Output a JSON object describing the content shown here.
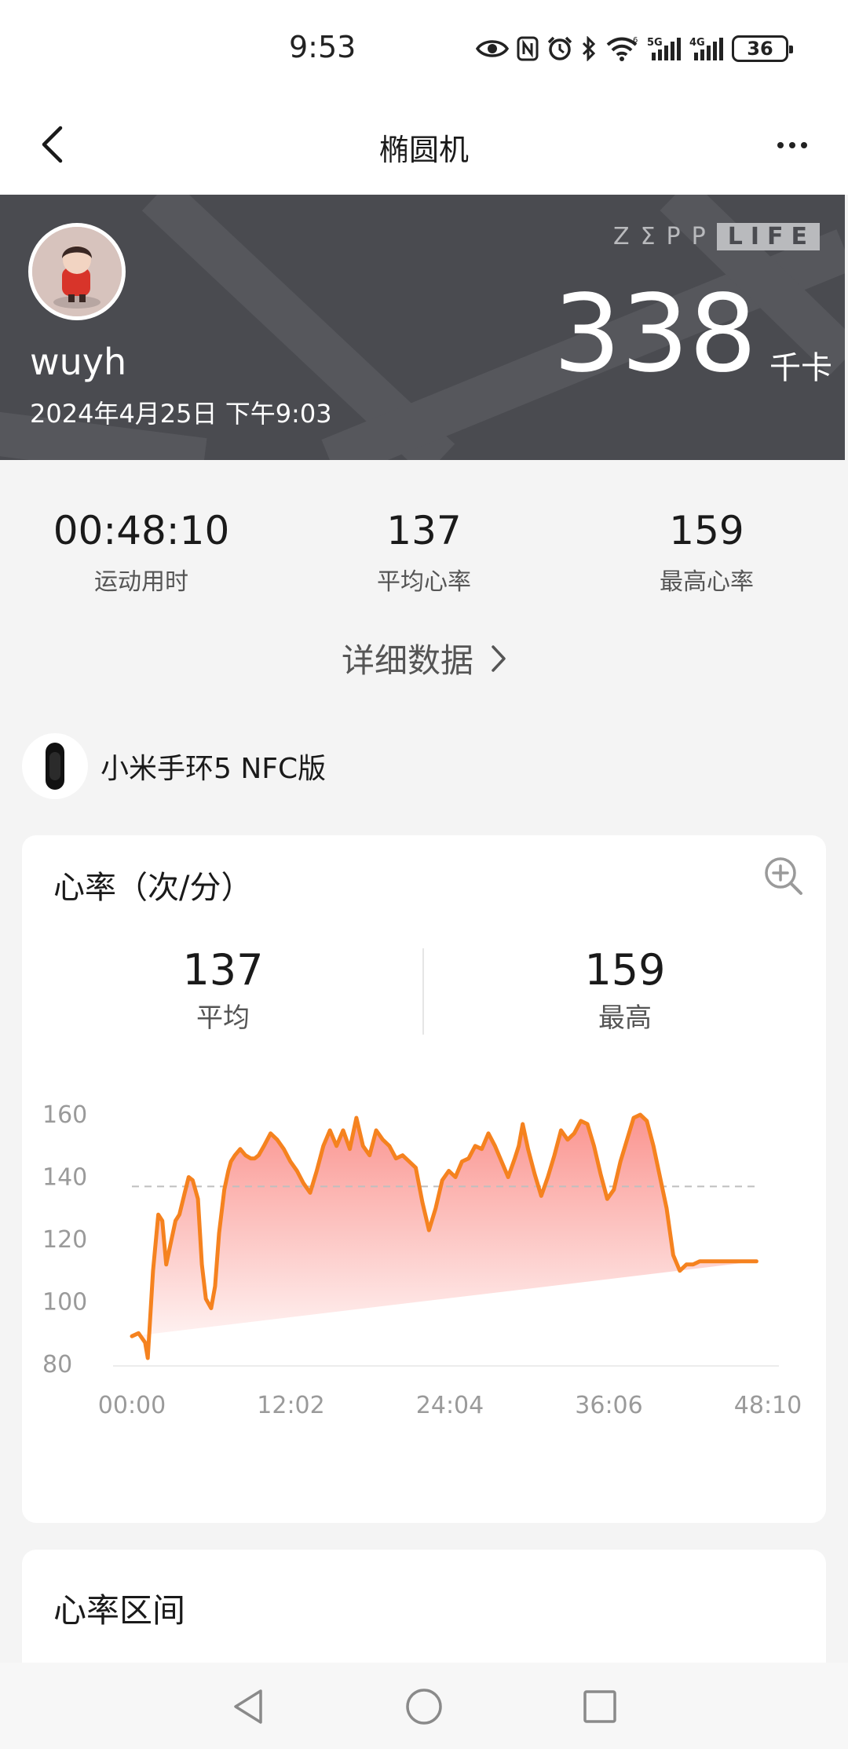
{
  "status_bar": {
    "time": "9:53",
    "battery": "36",
    "icons": [
      "eye-icon",
      "nfc-icon",
      "alarm-icon",
      "bluetooth-icon",
      "wifi-icon",
      "signal-5g-icon",
      "signal-4g-icon"
    ]
  },
  "nav": {
    "title": "椭圆机",
    "back_icon": "chevron-left-icon",
    "more_icon": "more-horizontal-icon"
  },
  "hero": {
    "username": "wuyh",
    "date": "2024年4月25日 下午9:03",
    "brand_zepp": "ZΣPP",
    "brand_life": "LIFE",
    "calories": "338",
    "calorie_unit": "千卡",
    "background_color": "#4a4b50"
  },
  "summary": {
    "duration_value": "00:48:10",
    "duration_label": "运动用时",
    "avg_hr_value": "137",
    "avg_hr_label": "平均心率",
    "max_hr_value": "159",
    "max_hr_label": "最高心率",
    "detail_link": "详细数据"
  },
  "device": {
    "name": "小米手环5 NFC版",
    "icon": "band-icon"
  },
  "heart_rate_card": {
    "title": "心率（次/分）",
    "zoom_icon": "zoom-in-icon",
    "avg_value": "137",
    "avg_label": "平均",
    "max_value": "159",
    "max_label": "最高"
  },
  "chart_data": {
    "type": "area",
    "title": "心率（次/分）",
    "xlabel": "",
    "ylabel": "",
    "x_ticks": [
      "00:00",
      "12:02",
      "24:04",
      "36:06",
      "48:10"
    ],
    "y_ticks": [
      160,
      140,
      120,
      100,
      80
    ],
    "ylim": [
      80,
      160
    ],
    "xlim_minutes": [
      0,
      48.17
    ],
    "reference_line": 137,
    "line_color": "#f5821f",
    "fill_color": "#fa8f8a",
    "x": [
      0,
      0.5,
      1,
      1.2,
      1.6,
      2,
      2.3,
      2.6,
      3,
      3.3,
      3.6,
      4,
      4.3,
      4.6,
      5,
      5.3,
      5.6,
      6,
      6.3,
      6.6,
      7,
      7.3,
      7.5,
      7.8,
      8.2,
      8.6,
      9,
      9.3,
      9.6,
      10,
      10.5,
      11,
      11.5,
      12,
      12.5,
      13,
      13.5,
      14,
      14.5,
      15,
      15.5,
      16,
      16.5,
      17,
      17.5,
      18,
      18.5,
      19,
      19.5,
      20,
      20.5,
      21,
      21.5,
      22,
      22.5,
      23,
      23.5,
      24,
      24.5,
      25,
      25.5,
      26,
      26.5,
      27,
      27.5,
      28,
      28.5,
      29,
      29.3,
      29.6,
      30,
      30.5,
      31,
      31.5,
      32,
      32.5,
      33,
      33.5,
      34,
      34.5,
      35,
      35.5,
      36,
      36.5,
      37,
      37.5,
      38,
      38.5,
      39,
      39.5,
      40,
      40.5,
      41,
      41.5,
      42,
      42.5,
      43,
      43.5,
      44,
      44.5,
      45,
      45.5,
      46,
      46.5,
      47,
      47.3,
      47.6,
      48.17
    ],
    "values": [
      89,
      90,
      87,
      82,
      110,
      128,
      126,
      112,
      120,
      126,
      128,
      135,
      140,
      139,
      133,
      112,
      101,
      98,
      105,
      122,
      136,
      142,
      145,
      147,
      149,
      147,
      146,
      146,
      147,
      150,
      154,
      152,
      149,
      145,
      142,
      138,
      135,
      142,
      150,
      155,
      150,
      155,
      149,
      159,
      150,
      147,
      155,
      152,
      150,
      146,
      147,
      145,
      143,
      132,
      123,
      130,
      139,
      142,
      140,
      145,
      146,
      150,
      149,
      154,
      150,
      145,
      140,
      146,
      150,
      157,
      149,
      141,
      134,
      140,
      147,
      155,
      152,
      154,
      158,
      157,
      150,
      141,
      133,
      136,
      145,
      152,
      159,
      160,
      158,
      150,
      140,
      130,
      115,
      110,
      112,
      112,
      113,
      113,
      113,
      113,
      113,
      113,
      113,
      113,
      113,
      113
    ]
  },
  "zones_card": {
    "title": "心率区间"
  },
  "system_nav": {
    "back_icon": "triangle-back-icon",
    "home_icon": "circle-home-icon",
    "recents_icon": "square-recents-icon"
  }
}
